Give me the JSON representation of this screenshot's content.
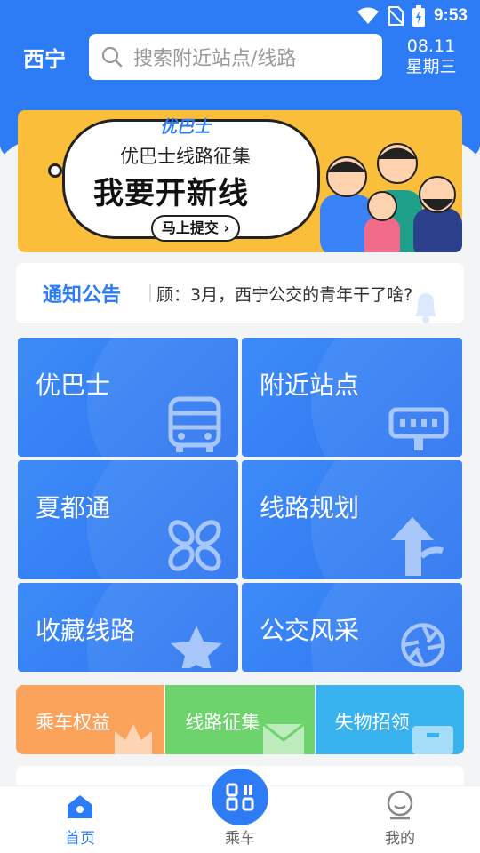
{
  "status_bar": {
    "time": "9:53"
  },
  "header": {
    "city": "西宁",
    "search_placeholder": "搜索附近站点/线路",
    "date": "08.11",
    "weekday": "星期三"
  },
  "banner": {
    "brand": "优巴士",
    "line1": "优巴士线路征集",
    "line2": "我要开新线",
    "cta": "马上提交 ›"
  },
  "notice": {
    "label": "通知公告",
    "text": "顾：3月，西宁公交的青年干了啥?"
  },
  "tiles": [
    {
      "label": "优巴士",
      "icon": "bus-icon"
    },
    {
      "label": "附近站点",
      "icon": "bus-stop-sign-icon"
    },
    {
      "label": "夏都通",
      "icon": "flower-icon"
    },
    {
      "label": "线路规划",
      "icon": "route-arrow-icon"
    },
    {
      "label": "收藏线路",
      "icon": "star-icon"
    },
    {
      "label": "公交风采",
      "icon": "camera-aperture-icon"
    }
  ],
  "strip": [
    {
      "label": "乘车权益",
      "icon": "crown-icon",
      "color": "#fba35b"
    },
    {
      "label": "线路征集",
      "icon": "mail-icon",
      "color": "#6dd36c"
    },
    {
      "label": "失物招领",
      "icon": "box-icon",
      "color": "#39b3ef"
    }
  ],
  "tabbar": {
    "home": "首页",
    "ride": "乘车",
    "mine": "我的"
  },
  "colors": {
    "primary": "#2d7cf6"
  }
}
